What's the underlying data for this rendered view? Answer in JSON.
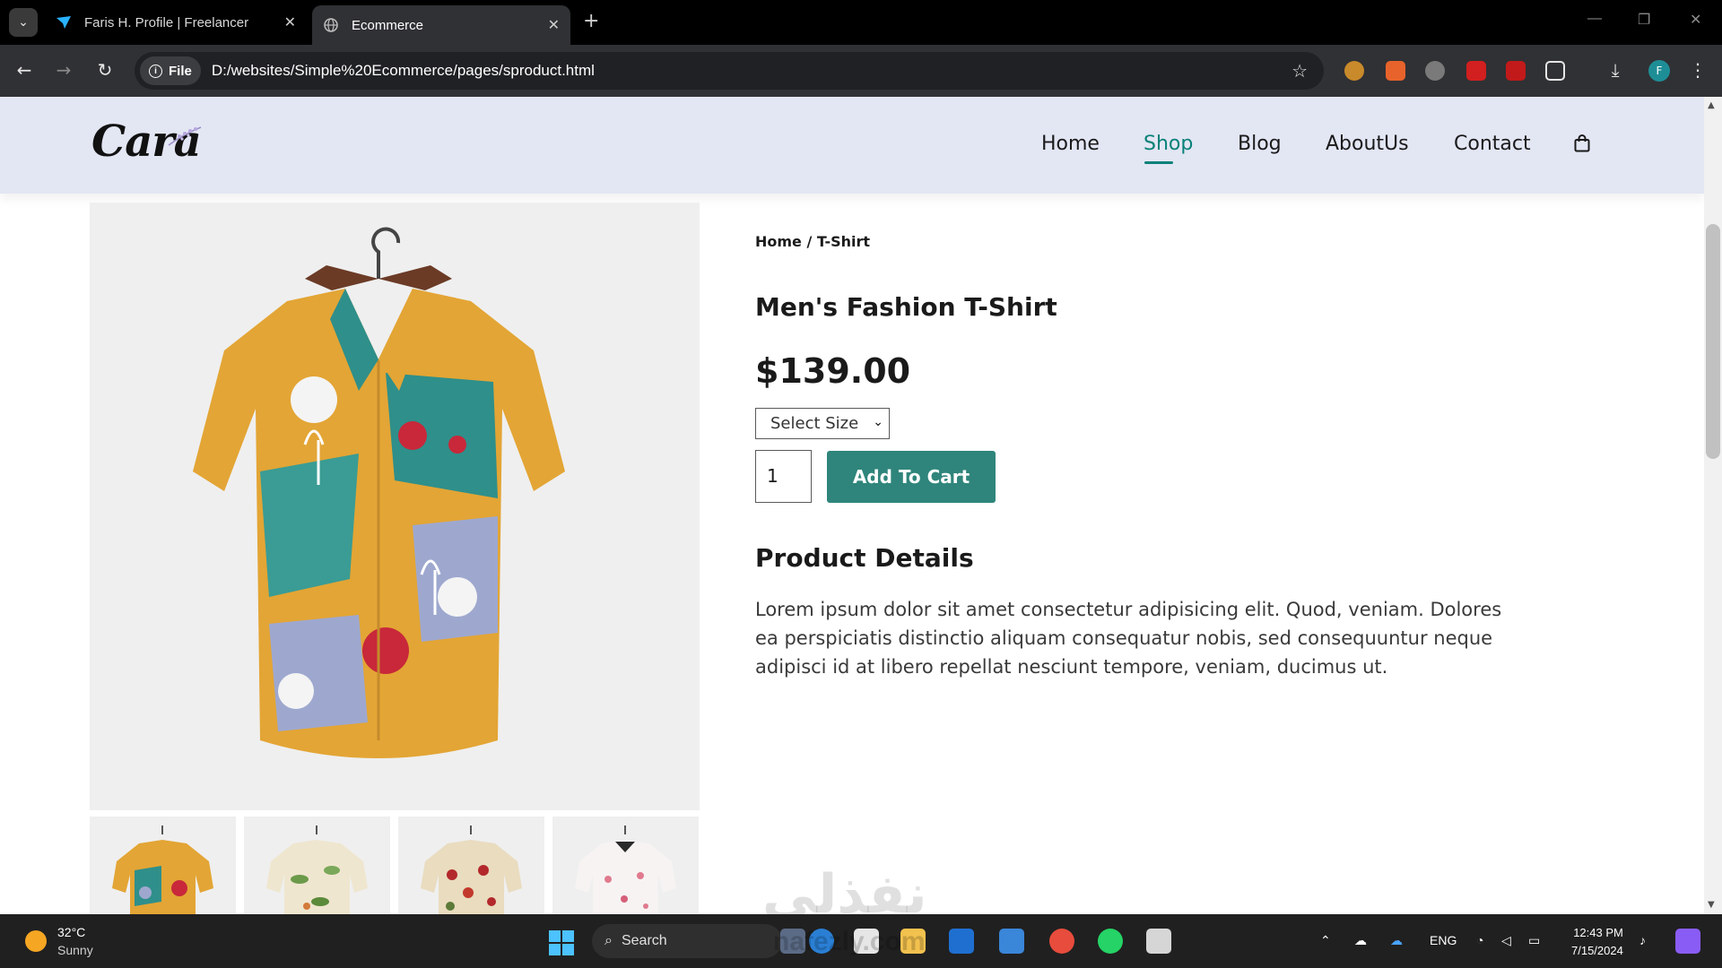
{
  "browser": {
    "tabs": [
      {
        "title": "Faris H. Profile | Freelancer",
        "active": false
      },
      {
        "title": "Ecommerce",
        "active": true
      }
    ],
    "address": {
      "chip": "File",
      "url": "D:/websites/Simple%20Ecommerce/pages/sproduct.html"
    },
    "profile_initial": "F",
    "icons": [
      "tab-search-icon",
      "back-icon",
      "forward-icon",
      "reload-icon",
      "bookmark-star-icon",
      "download-icon",
      "menu-icon"
    ]
  },
  "site": {
    "logo": "Cara",
    "nav": [
      {
        "label": "Home",
        "active": false
      },
      {
        "label": "Shop",
        "active": true
      },
      {
        "label": "Blog",
        "active": false
      },
      {
        "label": "AboutUs",
        "active": false
      },
      {
        "label": "Contact",
        "active": false
      }
    ],
    "accent_color": "#088178",
    "header_bg": "#e3e6f3"
  },
  "product": {
    "breadcrumb": "Home / T-Shirt",
    "title": "Men's Fashion T-Shirt",
    "price": "$139.00",
    "size_select": "Select Size",
    "quantity": "1",
    "add_to_cart": "Add To Cart",
    "details_title": "Product Details",
    "details_text": "Lorem ipsum dolor sit amet consectetur adipisicing elit. Quod, veniam. Dolores ea perspiciatis distinctio aliquam consequatur nobis, sed consequuntur neque adipisci id at libero repellat nesciunt tempore, veniam, ducimus ut.",
    "button_color": "#2f857b",
    "thumbnails": [
      "shirt-multicolor",
      "shirt-tropical-green",
      "shirt-floral-red",
      "shirt-floral-pink"
    ]
  },
  "watermark": {
    "arabic": "نفذلي",
    "latin": "nafezly.com"
  },
  "taskbar": {
    "weather_temp": "32°C",
    "weather_condition": "Sunny",
    "search_label": "Search",
    "language": "ENG",
    "time": "12:43 PM",
    "date": "7/15/2024"
  }
}
